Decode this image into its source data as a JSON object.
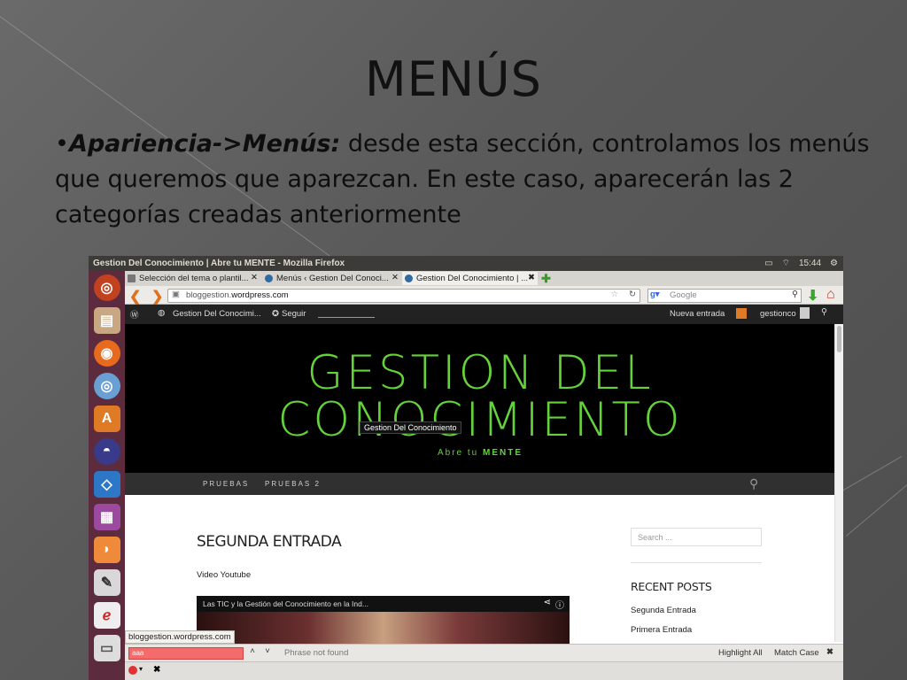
{
  "slide": {
    "title": "MENÚS",
    "body_bullet": "•",
    "body_bold": "Apariencia->Menús:",
    "body_text": " desde esta sección, controlamos los menús que queremos que aparezcan. En este caso, aparecerán las 2 categorías creadas anteriormente"
  },
  "window": {
    "title": "Gestion Del Conocimiento | Abre tu MENTE - Mozilla Firefox",
    "clock": "15:44"
  },
  "tabs": [
    {
      "label": "Selección del tema o plantil...",
      "close": "✕"
    },
    {
      "label": "Menús ‹ Gestion Del Conoci...",
      "close": "✕"
    },
    {
      "label": "Gestion Del Conocimiento | ...",
      "close": "✖"
    }
  ],
  "navbar": {
    "url_prefix": "bloggestion.",
    "url_domain": "wordpress.com",
    "search_placeholder": "Google"
  },
  "wpadmin": {
    "site_name": "Gestion Del Conocimi...",
    "follow": "Seguir",
    "new_post": "Nueva entrada",
    "user": "gestionco"
  },
  "site": {
    "title_line1": "GESTION DEL",
    "title_line2": "CONOCIMIENTO",
    "tagline_prefix": "Abre tu ",
    "tagline_strong": "MENTE",
    "tooltip": "Gestion Del Conocimiento",
    "menu": [
      "PRUEBAS",
      "PRUEBAS 2"
    ],
    "post_title": "SEGUNDA ENTRADA",
    "post_subtitle": "Video Youtube",
    "video_title": "Las TIC y la Gestión del Conocimiento en la Ind...",
    "search_placeholder": "Search ...",
    "recent_heading": "RECENT POSTS",
    "recent_posts": [
      "Segunda Entrada",
      "Primera Entrada"
    ]
  },
  "statusbar": {
    "url": "bloggestion.wordpress.com"
  },
  "findbar": {
    "input_value": "aaa",
    "message": "Phrase not found",
    "highlight": "Highlight All",
    "match_case": "Match Case"
  },
  "colors": {
    "launcher": "#5c2b3e",
    "brand_green": "#63d23b",
    "find_error": "#f36b6b"
  }
}
